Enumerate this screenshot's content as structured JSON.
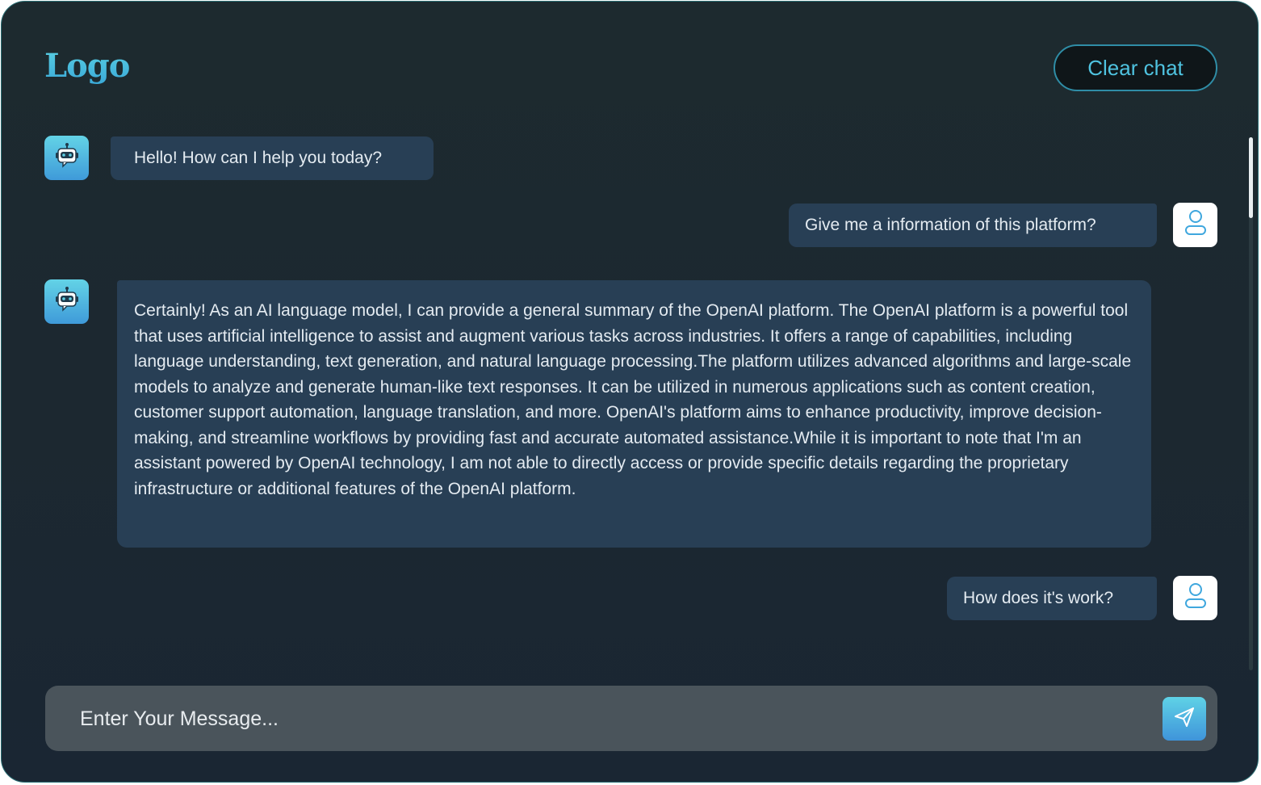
{
  "header": {
    "logo_text": "Logo",
    "clear_button_label": "Clear chat"
  },
  "messages": [
    {
      "sender": "bot",
      "text": "Hello! How can I help you today?"
    },
    {
      "sender": "user",
      "text": "Give me a information of this platform?"
    },
    {
      "sender": "bot",
      "text": "Certainly! As an AI language model, I can provide a general summary of the OpenAI platform. The OpenAI platform is a powerful tool that uses artificial intelligence to assist and augment various tasks across industries. It offers a range of capabilities, including language understanding, text generation, and natural language processing.The platform utilizes advanced algorithms and large-scale models to analyze and generate human-like text responses. It can be utilized in numerous applications such as content creation, customer support automation, language translation, and more. OpenAI's platform aims to enhance productivity, improve decision-making, and streamline workflows by providing fast and accurate automated assistance.While it is important to note that I'm an assistant powered by OpenAI technology, I am not able to directly access or provide specific details regarding the proprietary infrastructure or additional features of the OpenAI platform."
    },
    {
      "sender": "user",
      "text": "How does it's work?"
    }
  ],
  "composer": {
    "placeholder": "Enter Your Message...",
    "value": ""
  },
  "icons": {
    "bot_avatar": "robot-icon",
    "user_avatar": "user-icon",
    "send": "send-icon"
  },
  "colors": {
    "accent": "#4fc3e0",
    "bubble": "#283f55",
    "background": "#1d2a2f",
    "input": "#4a545b"
  }
}
